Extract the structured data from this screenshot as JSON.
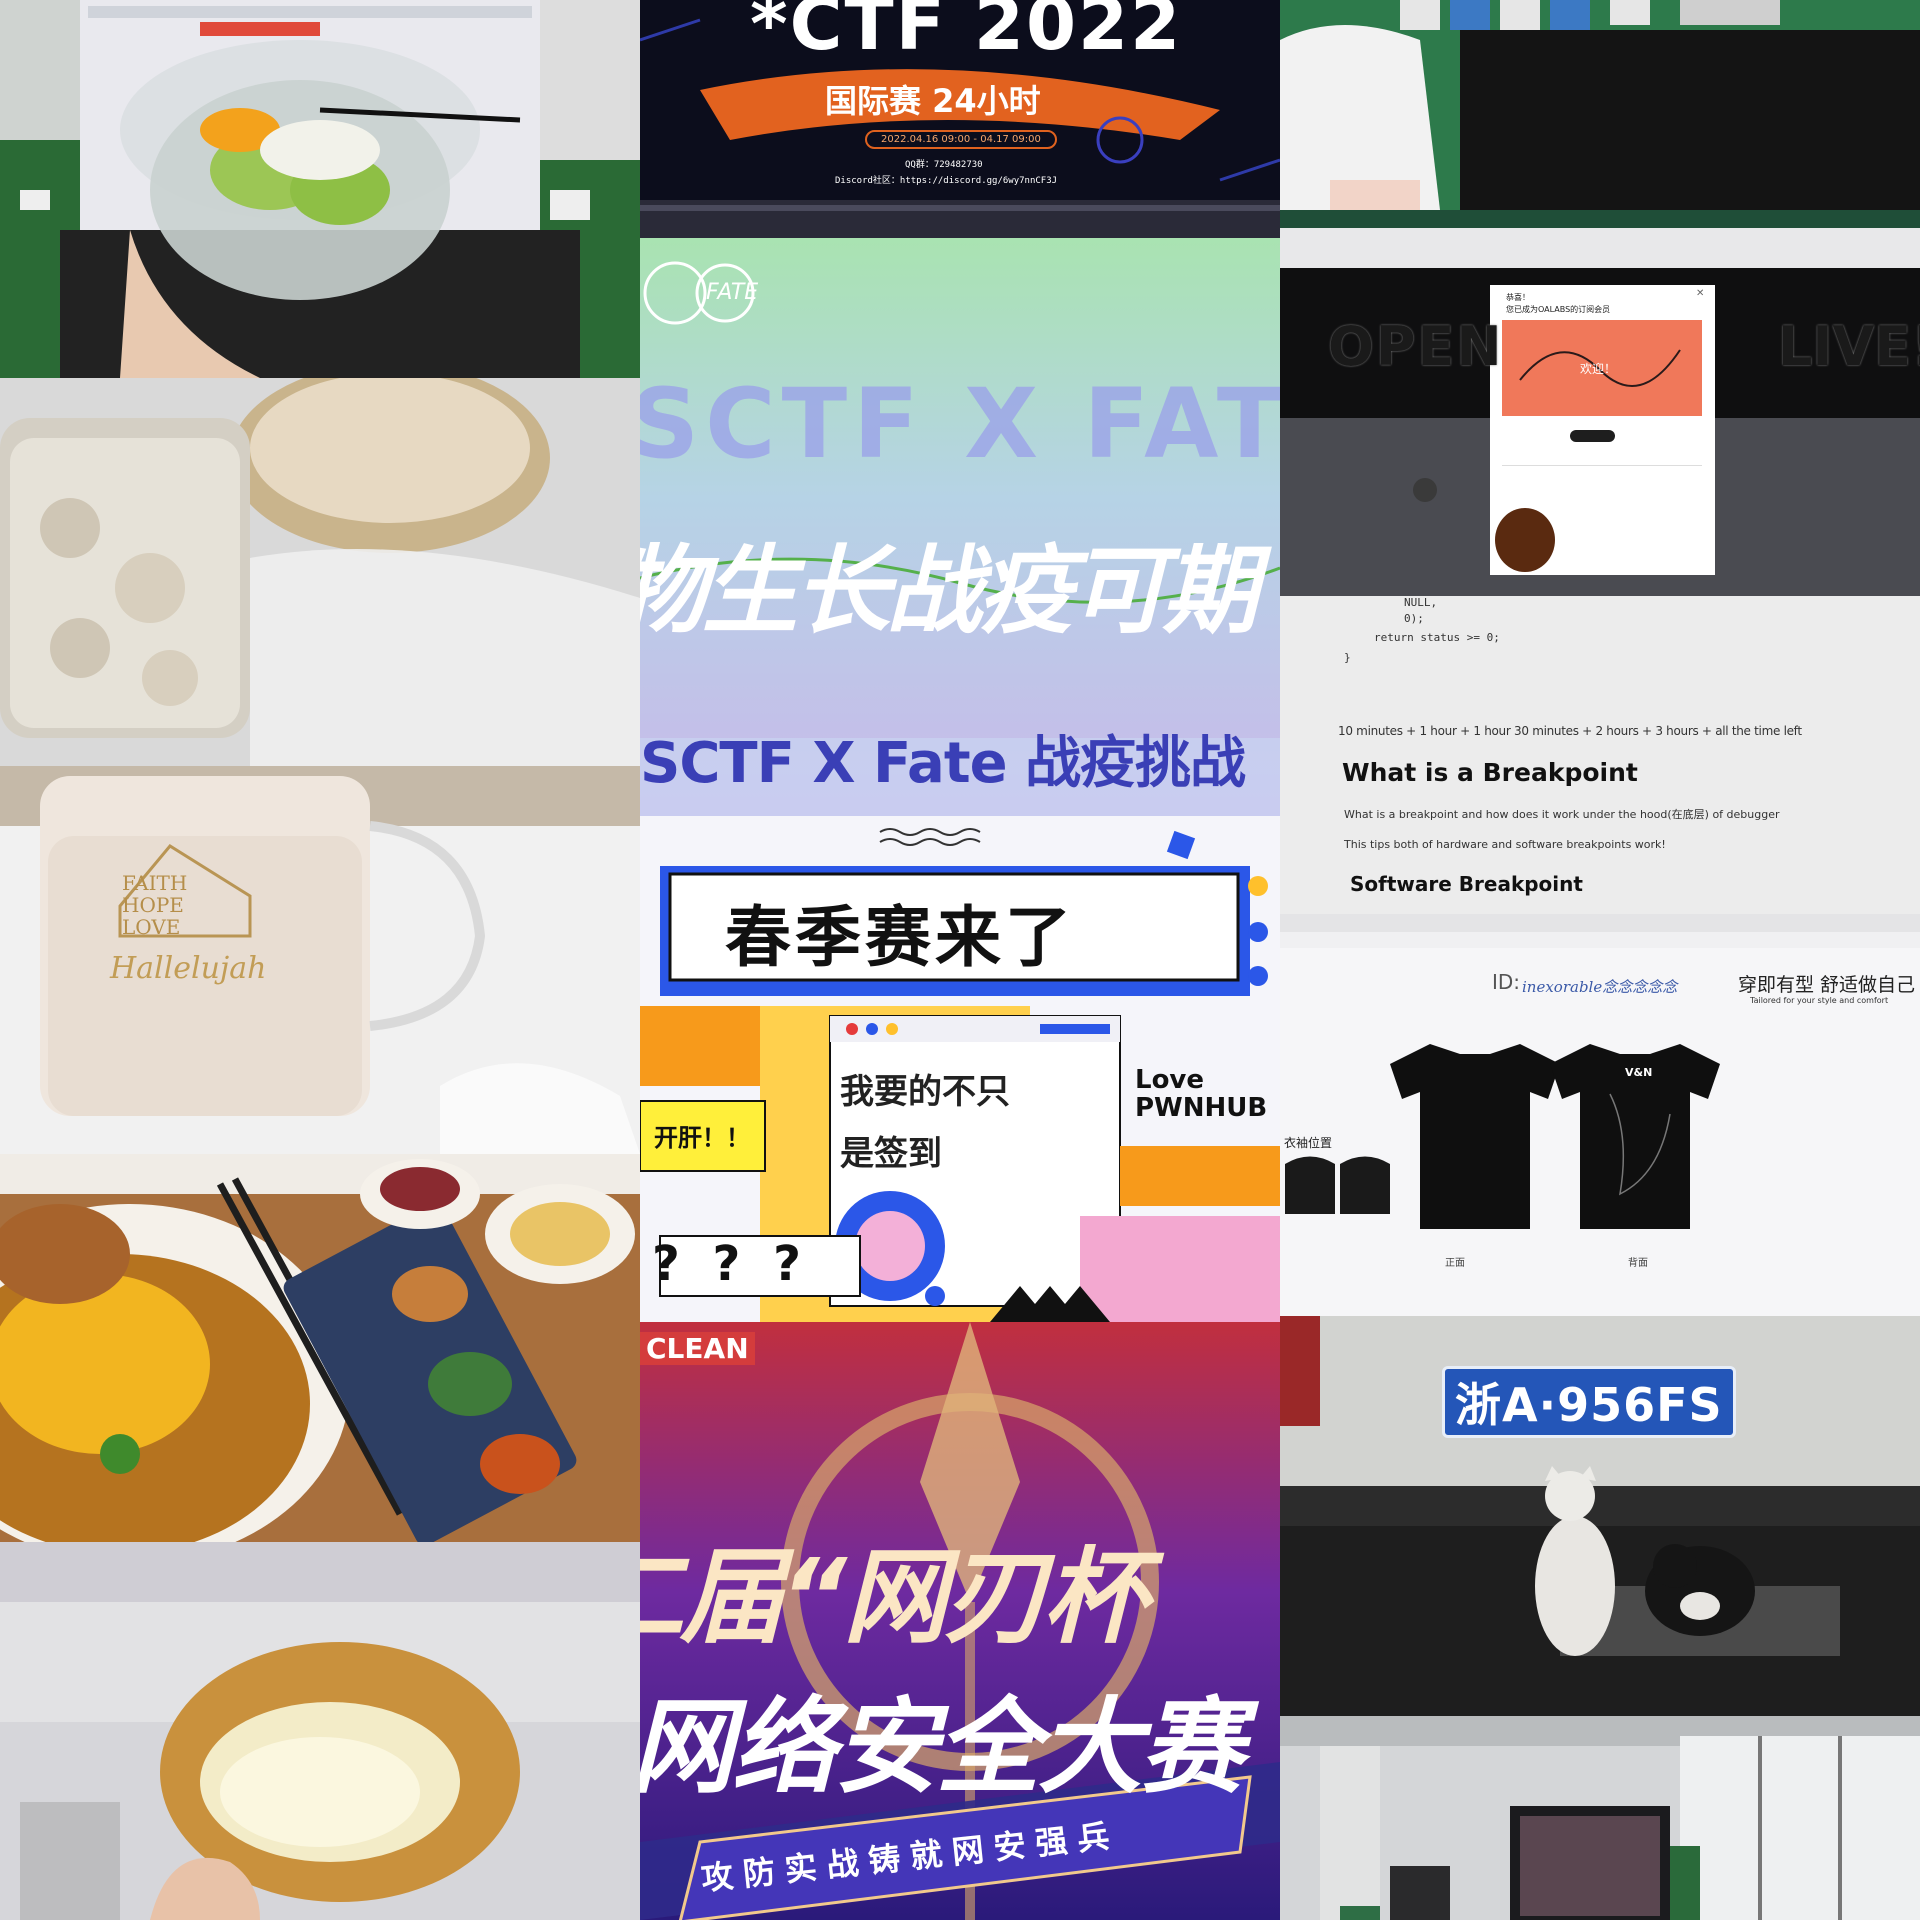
{
  "col2": {
    "ctf": {
      "title": "*CTF 2022",
      "subtitle": "国际赛 24小时",
      "time": "2022.04.16 09:00 - 04.17 09:00",
      "qq": "QQ群：729482730",
      "discord": "Discord社区：https://discord.gg/6wy7nnCF3J"
    },
    "sctf": {
      "logo": "FATE",
      "bg_text": "SCTF X FAT",
      "brush_text": "物生长战疫可期",
      "headline": "SCTF X Fate 战疫挑战"
    },
    "spring": {
      "title": "春季赛来了",
      "bubble1": "我要的不只",
      "bubble2": "是签到",
      "tag": "开肝！！",
      "love1": "Love",
      "love2": "PWNHUB",
      "q": "? ? ?"
    },
    "wangren": {
      "corner": "CLEAN",
      "line1": "二届“网刃杯",
      "line2": "网络安全大赛",
      "banner": "攻防实战铸就网安强兵"
    }
  },
  "col3": {
    "oalabs": {
      "popup_title": "恭喜！",
      "popup_sub": "您已成为OALABS的订阅会员",
      "welcome": "欢迎！",
      "bg_text_left": "OPEN",
      "bg_text_right": "LIVE!"
    },
    "breakpoint": {
      "code1": "NULL,",
      "code2": "0);",
      "code3": "return status >= 0;",
      "code4": "}",
      "time": "10 minutes + 1 hour + 1 hour 30 minutes + 2 hours + 3 hours + all the time left",
      "heading": "What is a Breakpoint",
      "p1": "What is a breakpoint and how does it work under the hood(在底层) of debugger",
      "p2": "This tips both of hardware and software breakpoints work!",
      "sub": "Software Breakpoint"
    },
    "tshirt": {
      "id_label": "ID:",
      "id_value": "inexorable念念念念念",
      "slogan": "穿即有型 舒适做自己",
      "slogan_en": "Tailored for your style and comfort",
      "side": "衣袖位置",
      "front": "正面",
      "back": "背面",
      "back_logo": "V&N"
    },
    "car": {
      "plate": "浙A·956FS"
    }
  },
  "col1": {
    "mug": {
      "line1": "FAITH",
      "line2": "HOPE",
      "line3": "LOVE",
      "script": "Hallelujah"
    }
  }
}
